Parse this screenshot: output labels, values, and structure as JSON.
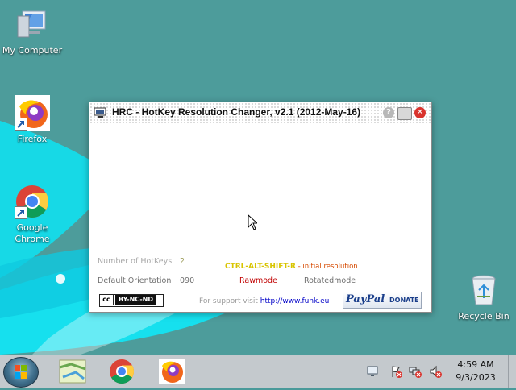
{
  "desktop": {
    "icons": [
      {
        "label": "My Computer"
      },
      {
        "label": "Firefox"
      },
      {
        "label": "Google Chrome"
      },
      {
        "label": "Recycle Bin"
      }
    ]
  },
  "window": {
    "title": "HRC - HotKey Resolution Changer, v2.1 (2012-May-16)",
    "help_glyph": "?",
    "close_glyph": "✕",
    "number_of_hotkeys_label": "Number of HotKeys",
    "number_of_hotkeys_value": "2",
    "hotkey_combo": "CTRL-ALT-SHIFT-R",
    "hotkey_desc": " - initial resolution",
    "default_orientation_label": "Default Orientation",
    "default_orientation_value": "090",
    "rawmode_label": "Rawmode",
    "rotatedmode_label": "Rotatedmode",
    "cc_symbol": "cc",
    "cc_license": "BY-NC-ND",
    "support_text": "For support visit",
    "support_link": "http://www.funk.eu",
    "paypal_logo": "PayPal",
    "paypal_donate": "DONATE"
  },
  "clock": {
    "time": "4:59 AM",
    "date": "9/3/2023"
  },
  "colors": {
    "desktop_teal": "#4d9c9b",
    "swoosh_cyan": "#16e0ee",
    "close_red": "#d9332d"
  }
}
